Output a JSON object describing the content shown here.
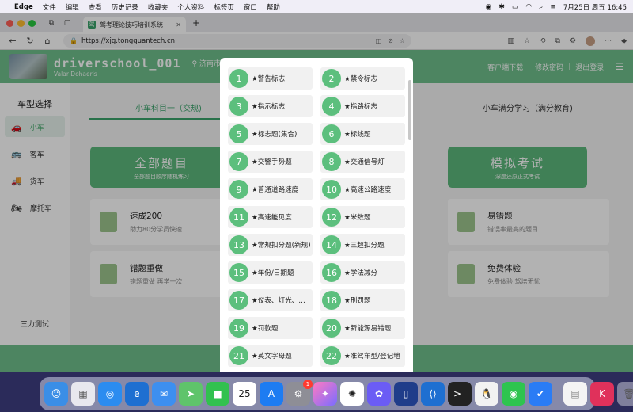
{
  "menubar": {
    "app": "Edge",
    "items": [
      "文件",
      "编辑",
      "查看",
      "历史记录",
      "收藏夹",
      "个人资料",
      "标签页",
      "窗口",
      "帮助"
    ],
    "datetime": "7月25日 周五 16:45"
  },
  "browser": {
    "tab_title": "驾考理论技巧培训系统",
    "url": "https://xjg.tongguantech.cn"
  },
  "site": {
    "brand_title": "driverschool_001",
    "brand_subtitle": "Valar Dohaeris",
    "city": "济南市 ›",
    "header_links": [
      "客户端下载",
      "修改密码",
      "退出登录"
    ],
    "sidebar_title": "车型选择",
    "vehicles": [
      {
        "label": "小车",
        "icon": "car-icon"
      },
      {
        "label": "客车",
        "icon": "bus-icon"
      },
      {
        "label": "货车",
        "icon": "truck-icon"
      },
      {
        "label": "摩托车",
        "icon": "motorcycle-icon"
      }
    ],
    "sidebar_bottom": "三力测试",
    "subtabs": [
      "小车科目一（交规)",
      "小车满分学习（满分教育)"
    ],
    "big_buttons": [
      {
        "title": "全部题目",
        "subtitle": "全部题目顺序随机练习"
      },
      {
        "title": "模拟考试",
        "subtitle": "深度还原正式考试"
      }
    ],
    "cards": [
      {
        "title": "速成200",
        "subtitle": "助力80分学员快速"
      },
      {
        "title": "错题重做",
        "subtitle": "错题重做 再学一次"
      },
      {
        "title": "易错题",
        "subtitle": "错误率最高的题目"
      },
      {
        "title": "免费体验",
        "subtitle": "免费体验 驾培无忧"
      }
    ]
  },
  "modal": {
    "items": [
      {
        "num": "1",
        "label": "★警告标志"
      },
      {
        "num": "2",
        "label": "★禁令标志"
      },
      {
        "num": "3",
        "label": "★指示标志"
      },
      {
        "num": "4",
        "label": "★指路标志"
      },
      {
        "num": "5",
        "label": "★标志题(集合)"
      },
      {
        "num": "6",
        "label": "★标线题"
      },
      {
        "num": "7",
        "label": "★交警手势题"
      },
      {
        "num": "8",
        "label": "★交通信号灯"
      },
      {
        "num": "9",
        "label": "★普通道路速度"
      },
      {
        "num": "10",
        "label": "★高速公路速度"
      },
      {
        "num": "11",
        "label": "★高速能见度"
      },
      {
        "num": "12",
        "label": "★米数题"
      },
      {
        "num": "13",
        "label": "★常规扣分题(新规)"
      },
      {
        "num": "14",
        "label": "★三超扣分题"
      },
      {
        "num": "15",
        "label": "★年份/日期题"
      },
      {
        "num": "16",
        "label": "★学法减分"
      },
      {
        "num": "17",
        "label": "★仪表、灯光、…"
      },
      {
        "num": "18",
        "label": "★刑罚题"
      },
      {
        "num": "19",
        "label": "★罚款题"
      },
      {
        "num": "20",
        "label": "★新能源易错题"
      },
      {
        "num": "21",
        "label": "★英文字母题"
      },
      {
        "num": "22",
        "label": "★准驾车型/登记地"
      }
    ]
  },
  "dock": {
    "calendar_day": "25",
    "settings_badge": "1"
  }
}
